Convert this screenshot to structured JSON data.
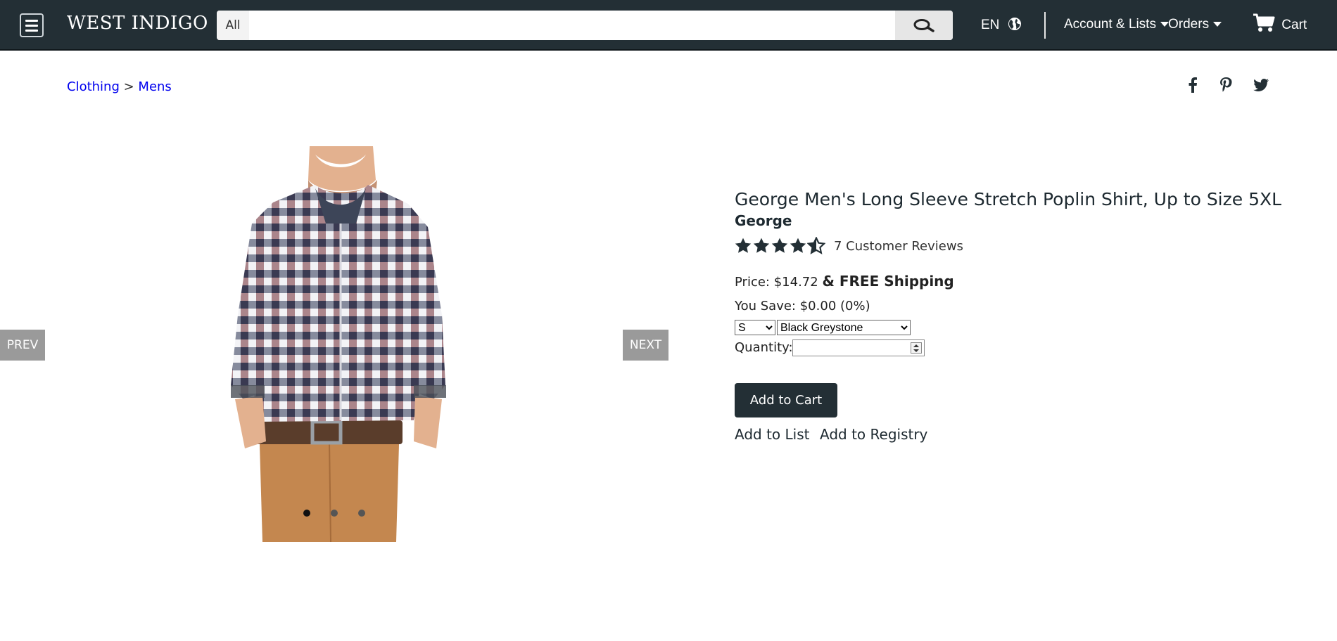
{
  "header": {
    "logo": "WEST INDIGO",
    "search_category": "All",
    "search_placeholder": "",
    "language": "EN",
    "account": "Account & Lists",
    "orders": "Orders",
    "cart": "Cart"
  },
  "breadcrumb": {
    "first": "Clothing",
    "separator": " > ",
    "second": "Mens"
  },
  "carousel": {
    "prev": "PREV",
    "next": "NEXT",
    "slides": 3,
    "active_slide": 1
  },
  "product": {
    "title": "George Men's Long Sleeve Stretch Poplin Shirt, Up to Size 5XL",
    "brand": "George",
    "rating": 4.5,
    "rating_max": 5,
    "reviews": "7 Customer Reviews",
    "price_label": "Price:",
    "price": "$14.72",
    "shipping": "& FREE Shipping",
    "save_label": "You Save:",
    "save_value": "$0.00 (0%)",
    "size": "S",
    "color": "Black Greystone",
    "quantity_label": "Quantity:",
    "quantity_value": "",
    "add_to_cart": "Add to Cart",
    "add_to_list": "Add to List",
    "add_to_registry": "Add to Registry"
  },
  "colors": {
    "header_bg": "#232f35",
    "link": "#0000ee",
    "button_bg": "#232f35",
    "nav_arrow_bg": "#9a9a9a"
  }
}
